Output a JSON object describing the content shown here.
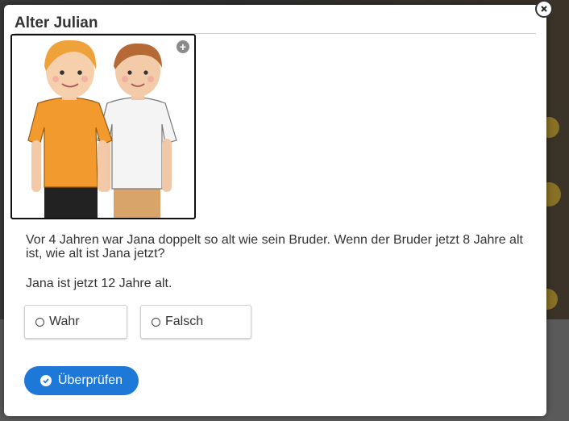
{
  "dialog": {
    "title": "Alter Julian",
    "question": "Vor 4 Jahren war Jana doppelt so alt wie sein Bruder. Wenn der Bruder jetzt 8 Jahre alt ist, wie alt ist Jana jetzt?",
    "statement": "Jana ist jetzt 12 Jahre alt.",
    "options": [
      {
        "label": "Wahr"
      },
      {
        "label": "Falsch"
      }
    ],
    "check_label": "Überprüfen",
    "close_icon": "close-icon",
    "expand_icon": "plus-icon"
  },
  "colors": {
    "accent": "#1e78d7"
  }
}
